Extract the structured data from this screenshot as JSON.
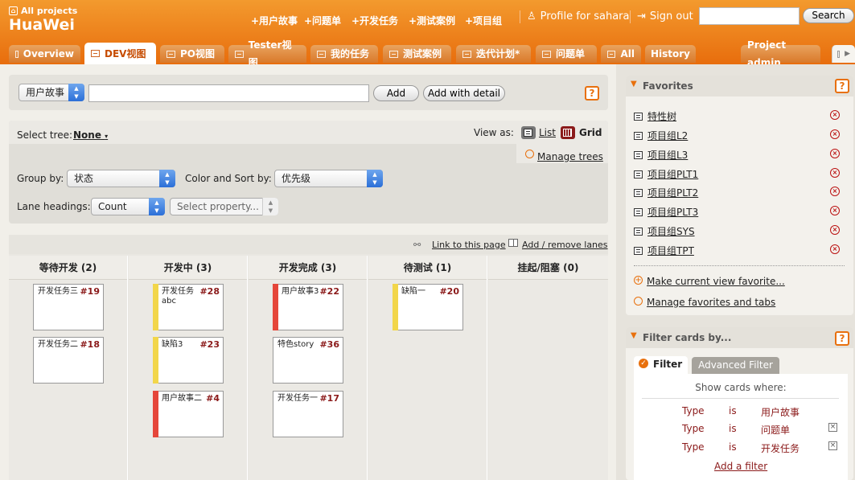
{
  "header": {
    "all_projects": "All projects",
    "brand": "HuaWei",
    "nav": [
      "+用户故事",
      "+问题单",
      "+开发任务",
      "+测试案例",
      "+项目组"
    ],
    "profile": "Profile for sahara",
    "signout": "Sign out",
    "search_value": "",
    "search_label": "Search",
    "brand_color": "#e8700d"
  },
  "tabs": [
    "Overview",
    "DEV视图",
    "PO视图",
    "Tester视图",
    "我的任务",
    "测试案例",
    "迭代计划*",
    "问题单",
    "All",
    "History",
    "Project admin"
  ],
  "active_tab": "DEV视图",
  "addbar": {
    "type_value": "用户故事",
    "title_value": "",
    "add_label": "Add",
    "add_detail_label": "Add with detail",
    "help": "?"
  },
  "settings": {
    "select_tree_label": "Select tree:",
    "select_tree_value": "None",
    "view_as_label": "View as:",
    "view_list": "List",
    "view_grid": "Grid",
    "manage_trees": "Manage trees",
    "group_by_label": "Group by:",
    "group_by_value": "状态",
    "color_sort_label": "Color and Sort by:",
    "color_sort_value": "优先级",
    "lane_headings_label": "Lane headings:",
    "lane_headings_value": "Count",
    "select_property": "Select property..."
  },
  "board": {
    "link_to_page": "Link to this page",
    "add_remove_lanes": "Add / remove lanes",
    "lanes": [
      {
        "title": "等待开发 (2)",
        "cards": [
          {
            "title": "开发任务三",
            "num": "#19",
            "color": ""
          },
          {
            "title": "开发任务二",
            "num": "#18",
            "color": ""
          }
        ]
      },
      {
        "title": "开发中 (3)",
        "cards": [
          {
            "title": "开发任务abc",
            "num": "#28",
            "color": "#f2d64a"
          },
          {
            "title": "缺陷3",
            "num": "#23",
            "color": "#f2d64a"
          },
          {
            "title": "用户故事二",
            "num": "#4",
            "color": "#e5463a"
          }
        ]
      },
      {
        "title": "开发完成 (3)",
        "cards": [
          {
            "title": "用户故事3",
            "num": "#22",
            "color": "#e5463a"
          },
          {
            "title": "特色story",
            "num": "#36",
            "color": ""
          },
          {
            "title": "开发任务一",
            "num": "#17",
            "color": ""
          }
        ]
      },
      {
        "title": "待测试 (1)",
        "cards": [
          {
            "title": "缺陷一",
            "num": "#20",
            "color": "#f2d64a"
          }
        ]
      },
      {
        "title": "挂起/阻塞 (0)",
        "cards": []
      }
    ]
  },
  "favorites": {
    "title": "Favorites",
    "help": "?",
    "items": [
      "特性树",
      "项目组L2",
      "项目组L3",
      "项目组PLT1",
      "项目组PLT2",
      "项目组PLT3",
      "项目组SYS",
      "项目组TPT"
    ],
    "make_favorite": "Make current view favorite...",
    "manage": "Manage favorites and tabs"
  },
  "filter": {
    "title": "Filter cards by...",
    "help": "?",
    "tab_filter": "Filter",
    "tab_advanced": "Advanced Filter",
    "show_where": "Show cards where:",
    "rows": [
      {
        "field": "Type",
        "op": "is",
        "value": "用户故事"
      },
      {
        "field": "Type",
        "op": "is",
        "value": "问题单"
      },
      {
        "field": "Type",
        "op": "is",
        "value": "开发任务"
      }
    ],
    "add_filter": "Add a filter"
  }
}
